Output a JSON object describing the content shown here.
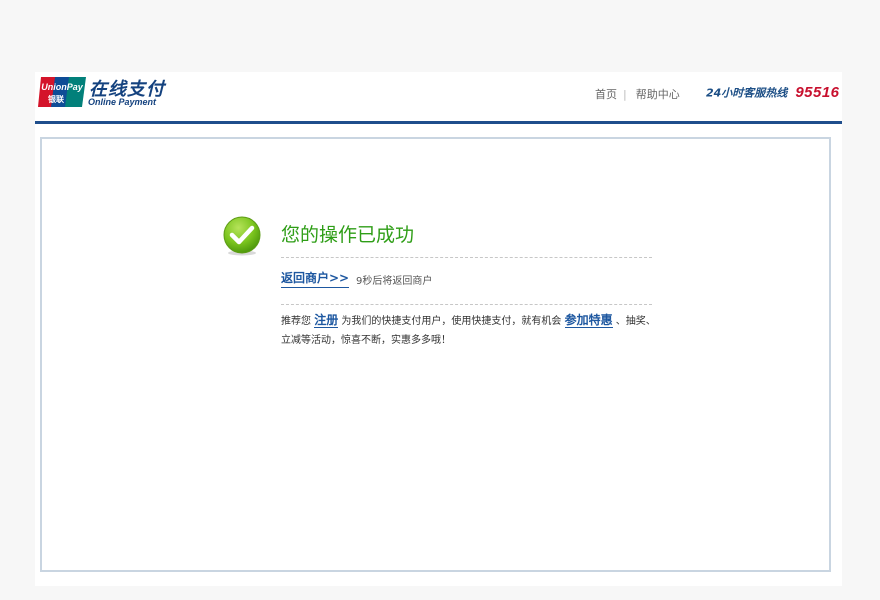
{
  "header": {
    "logo": {
      "brand_text": "UnionPay",
      "brand_cn": "银联",
      "title": "在线支付",
      "subtitle": "Online Payment"
    },
    "nav": {
      "home_label": "首页",
      "separator": "|",
      "help_label": "帮助中心"
    },
    "hotline": {
      "label": "24小时客服热线",
      "number": "95516"
    }
  },
  "result": {
    "title": "您的操作已成功",
    "return_link": "返回商户>>",
    "countdown": "9秒后将返回商户"
  },
  "promo": {
    "text_1": "推荐您",
    "register_link": "注册",
    "text_2": "为我们的快捷支付用户，使用快捷支付，就有机会",
    "offers_link": "参加特惠",
    "text_3": "、抽奖、立减等活动，惊喜不断，实惠多多哦！"
  },
  "colors": {
    "brand_blue": "#1f4e8c",
    "success_green": "#2f9e17",
    "link_blue": "#1d57a0",
    "hotline_red": "#c8102e"
  }
}
